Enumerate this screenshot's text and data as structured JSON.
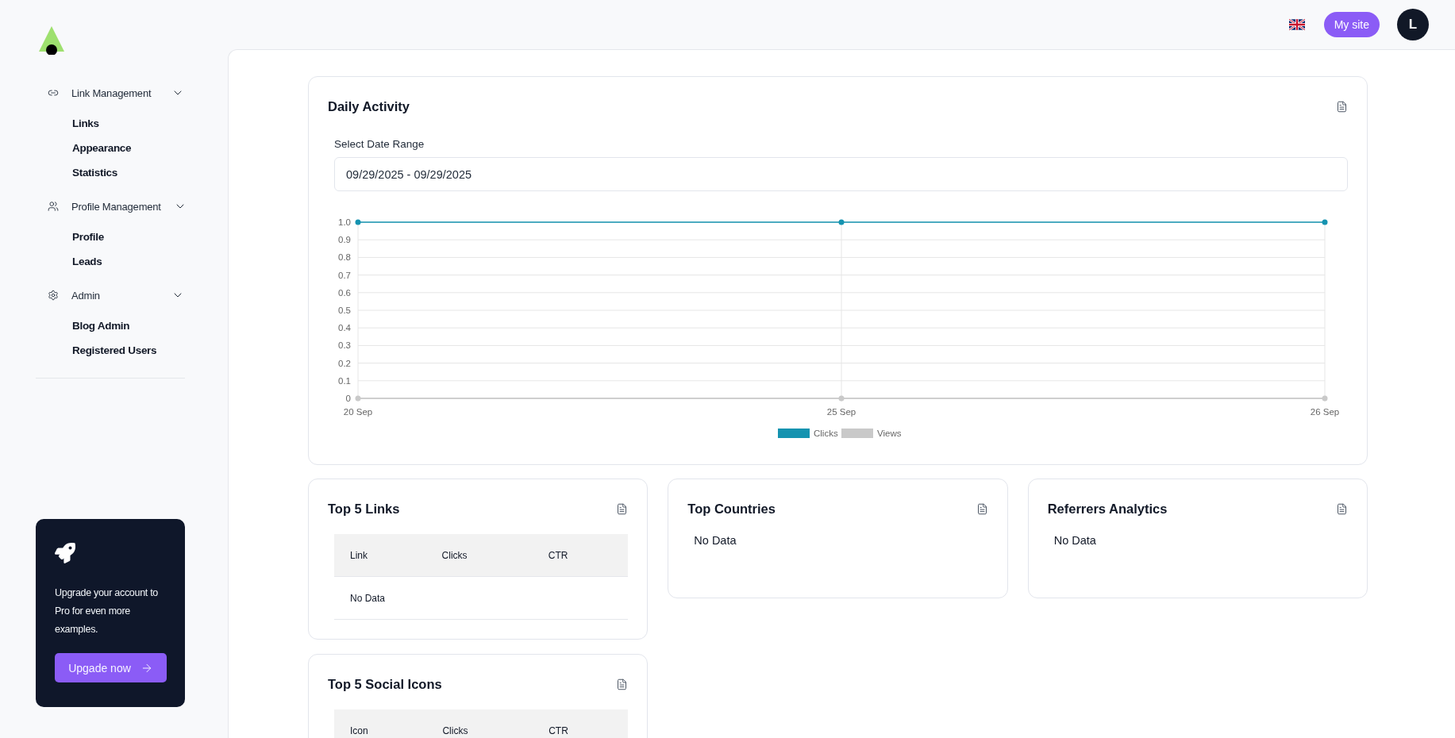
{
  "header": {
    "my_site_button": "My site",
    "avatar_initial": "L"
  },
  "sidebar": {
    "groups": [
      {
        "label": "Link Management",
        "expanded": true,
        "items": [
          {
            "label": "Links"
          },
          {
            "label": "Appearance"
          },
          {
            "label": "Statistics"
          }
        ]
      },
      {
        "label": "Profile Management",
        "expanded": true,
        "items": [
          {
            "label": "Profile"
          },
          {
            "label": "Leads"
          }
        ]
      },
      {
        "label": "Admin",
        "expanded": true,
        "items": [
          {
            "label": "Blog Admin"
          },
          {
            "label": "Registered Users"
          }
        ]
      }
    ],
    "upgrade": {
      "text": "Upgrade your account to Pro for even more examples.",
      "button": "Upgade now"
    }
  },
  "daily_activity": {
    "title": "Daily Activity",
    "date_range_label": "Select Date Range",
    "date_range_value": "09/29/2025 - 09/29/2025",
    "chart_data": {
      "type": "line",
      "categories": [
        "20 Sep",
        "25 Sep",
        "26 Sep"
      ],
      "series": [
        {
          "name": "Clicks",
          "color": "#1593b0",
          "marker": "circle",
          "values": [
            1,
            1,
            1
          ]
        },
        {
          "name": "Views",
          "color": "#c9c9c9",
          "marker": "circle",
          "values": [
            0,
            0,
            0
          ]
        }
      ],
      "grid": true,
      "legend": true,
      "ylim": [
        0,
        1
      ],
      "yticks": [
        {
          "value": 0,
          "label": "0"
        },
        {
          "value": 0.1,
          "label": "0.1"
        },
        {
          "value": 0.2,
          "label": "0.2"
        },
        {
          "value": 0.3,
          "label": "0.3"
        },
        {
          "value": 0.4,
          "label": "0.4"
        },
        {
          "value": 0.5,
          "label": "0.5"
        },
        {
          "value": 0.6,
          "label": "0.6"
        },
        {
          "value": 0.7,
          "label": "0.7"
        },
        {
          "value": 0.8,
          "label": "0.8"
        },
        {
          "value": 0.9,
          "label": "0.9"
        },
        {
          "value": 1,
          "label": "1.0"
        }
      ]
    }
  },
  "cards": [
    {
      "kind": "table",
      "title": "Top 5 Links",
      "columns": [
        "Link",
        "Clicks",
        "CTR"
      ],
      "empty_text": "No Data"
    },
    {
      "kind": "empty",
      "title": "Top Countries",
      "empty_text": "No Data"
    },
    {
      "kind": "empty",
      "title": "Referrers Analytics",
      "empty_text": "No Data"
    },
    {
      "kind": "table",
      "title": "Top 5 Social Icons",
      "columns": [
        "Icon",
        "Clicks",
        "CTR"
      ]
    }
  ]
}
